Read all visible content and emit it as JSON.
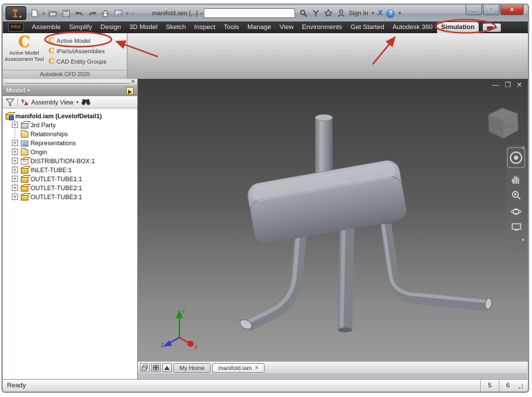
{
  "titlebar": {
    "title": "manifold.iam [...]",
    "search_placeholder": "",
    "sign_in": "Sign In"
  },
  "ribbon": {
    "pro_badge": "PRO",
    "tabs": [
      "Assemble",
      "Simplify",
      "Design",
      "3D Model",
      "Sketch",
      "Inspect",
      "Tools",
      "Manage",
      "View",
      "Environments",
      "Get Started",
      "Autodesk 360",
      "Simulation"
    ],
    "active_tab": "Simulation",
    "panel": {
      "assessment_tool_line1": "Active Model",
      "assessment_tool_line2": "Assessment Tool",
      "active_model": "Active Model",
      "iparts": "iParts/iAssemblies",
      "cad_entity": "CAD Entity Groups",
      "footer": "Autodesk CFD 2020"
    }
  },
  "browser": {
    "header": "Model",
    "view_mode": "Assembly View",
    "tree": [
      {
        "label": "manifold.iam (LevelofDetail1)",
        "icon": "assembly-icon"
      },
      {
        "label": "3rd Party",
        "icon": "third-party-icon"
      },
      {
        "label": "Relationships",
        "icon": "folder-icon"
      },
      {
        "label": "Representations",
        "icon": "representations-icon"
      },
      {
        "label": "Origin",
        "icon": "folder-icon"
      },
      {
        "label": "DISTRIBUTION-BOX:1",
        "icon": "substitute-part-icon"
      },
      {
        "label": "INLET-TUBE:1",
        "icon": "part-icon"
      },
      {
        "label": "OUTLET-TUBE1:1",
        "icon": "part-icon"
      },
      {
        "label": "OUTLET-TUBE2:1",
        "icon": "part-icon"
      },
      {
        "label": "OUTLET-TUBE3:1",
        "icon": "part-icon"
      }
    ]
  },
  "viewport": {
    "viewcube_face": "RIGHT",
    "triad": {
      "x": "X",
      "y": "Y",
      "z": "Z"
    }
  },
  "doc_tabs": {
    "tabs": [
      {
        "label": "My Home"
      },
      {
        "label": "manifold.iam"
      }
    ],
    "active": "manifold.iam"
  },
  "status": {
    "message": "Ready",
    "counters": [
      "5",
      "6"
    ]
  },
  "colors": {
    "annotation_red": "#bf392b",
    "brand_orange": "#e8940c",
    "viewport_top": "#3d3d3d",
    "viewport_bottom": "#9c9c9c"
  }
}
